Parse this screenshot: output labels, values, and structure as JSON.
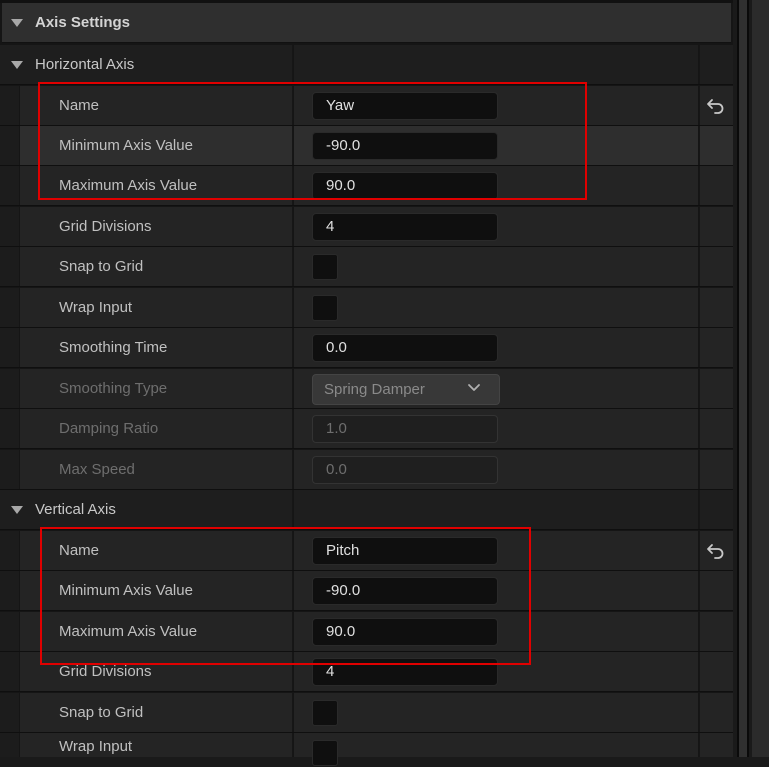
{
  "section": {
    "title": "Axis Settings"
  },
  "horizontal": {
    "title": "Horizontal Axis",
    "name": {
      "label": "Name",
      "value": "Yaw"
    },
    "min": {
      "label": "Minimum Axis Value",
      "value": "-90.0"
    },
    "max": {
      "label": "Maximum Axis Value",
      "value": "90.0"
    },
    "grid_divisions": {
      "label": "Grid Divisions",
      "value": "4"
    },
    "snap_to_grid": {
      "label": "Snap to Grid",
      "checked": false
    },
    "wrap_input": {
      "label": "Wrap Input",
      "checked": false
    },
    "smoothing_time": {
      "label": "Smoothing Time",
      "value": "0.0"
    },
    "smoothing_type": {
      "label": "Smoothing Type",
      "value": "Spring Damper"
    },
    "damping_ratio": {
      "label": "Damping Ratio",
      "value": "1.0"
    },
    "max_speed": {
      "label": "Max Speed",
      "value": "0.0"
    }
  },
  "vertical": {
    "title": "Vertical Axis",
    "name": {
      "label": "Name",
      "value": "Pitch"
    },
    "min": {
      "label": "Minimum Axis Value",
      "value": "-90.0"
    },
    "max": {
      "label": "Maximum Axis Value",
      "value": "90.0"
    },
    "grid_divisions": {
      "label": "Grid Divisions",
      "value": "4"
    },
    "snap_to_grid": {
      "label": "Snap to Grid",
      "checked": false
    },
    "wrap_input": {
      "label": "Wrap Input",
      "checked": false
    }
  },
  "colors": {
    "highlight_box": "#e00000",
    "panel_bg": "#242424",
    "field_bg": "#0f0f0f"
  }
}
